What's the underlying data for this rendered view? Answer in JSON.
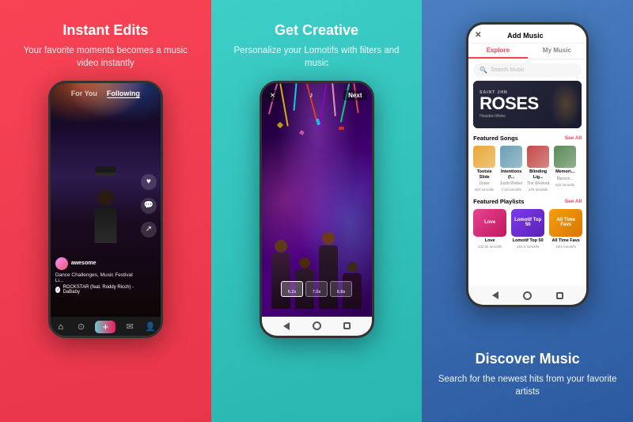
{
  "panels": {
    "left": {
      "title": "Instant Edits",
      "subtitle": "Your favorite moments becomes a music video instantly",
      "phone": {
        "tabs": [
          "For You",
          "Following"
        ],
        "active_tab": "For You",
        "username": "awesome",
        "caption": "Dance Challenges, Music Festival Li...",
        "music": "ROCKSTAR (feat. Roddy Ricch) - DaBaby",
        "right_actions": [
          "♥",
          "💬",
          "↗"
        ],
        "nav": [
          "⌂",
          "⊙",
          "+",
          "✉",
          "👤"
        ]
      }
    },
    "middle": {
      "title": "Get Creative",
      "subtitle": "Personalize your Lomotifs with filters and music",
      "phone": {
        "close": "✕",
        "next": "Next",
        "music_note": "♪",
        "clips": [
          "6.2s",
          "7.0s",
          "6.8s"
        ]
      }
    },
    "right": {
      "title": "Discover Music",
      "subtitle": "Search for the newest hits from your favorite artists",
      "phone": {
        "header": "Add Music",
        "tabs": [
          "Explore",
          "My Music"
        ],
        "active_tab": "Explore",
        "search_placeholder": "Search Music",
        "featured_album": {
          "pre_title": "SAINT JHN",
          "title": "ROSES",
          "sub_title": "Houston Metro"
        },
        "featured_songs_label": "Featured Songs",
        "see_all": "See All",
        "songs": [
          {
            "title": "Tootsie Slide",
            "artist": "Drake",
            "stats": "907 lomotifs",
            "color": "#e8a838"
          },
          {
            "title": "Intentions (f...",
            "artist": "Justin Bieber",
            "stats": "7.1k lomotifs",
            "color": "#6a9fb5"
          },
          {
            "title": "Blinding Lig...",
            "artist": "The Weeknd",
            "stats": "378 lomotifs",
            "color": "#c44a4a"
          },
          {
            "title": "Memori...",
            "artist": "Maroon...",
            "stats": "51k lomotifs",
            "color": "#5a8a5a"
          }
        ],
        "featured_playlists_label": "Featured Playlists",
        "playlists_see_all": "See All",
        "playlists": [
          {
            "title": "Love",
            "stats": "243.2k lomotifs",
            "color1": "#e84393",
            "color2": "#c2185b"
          },
          {
            "title": "Lomotif Top 50",
            "stats": "161.6 lomotifs",
            "color1": "#7c3aed",
            "color2": "#5b21b6"
          },
          {
            "title": "All Time Favs",
            "stats": "18m lomotifs",
            "color1": "#f59e0b",
            "color2": "#d97706"
          }
        ]
      }
    }
  }
}
